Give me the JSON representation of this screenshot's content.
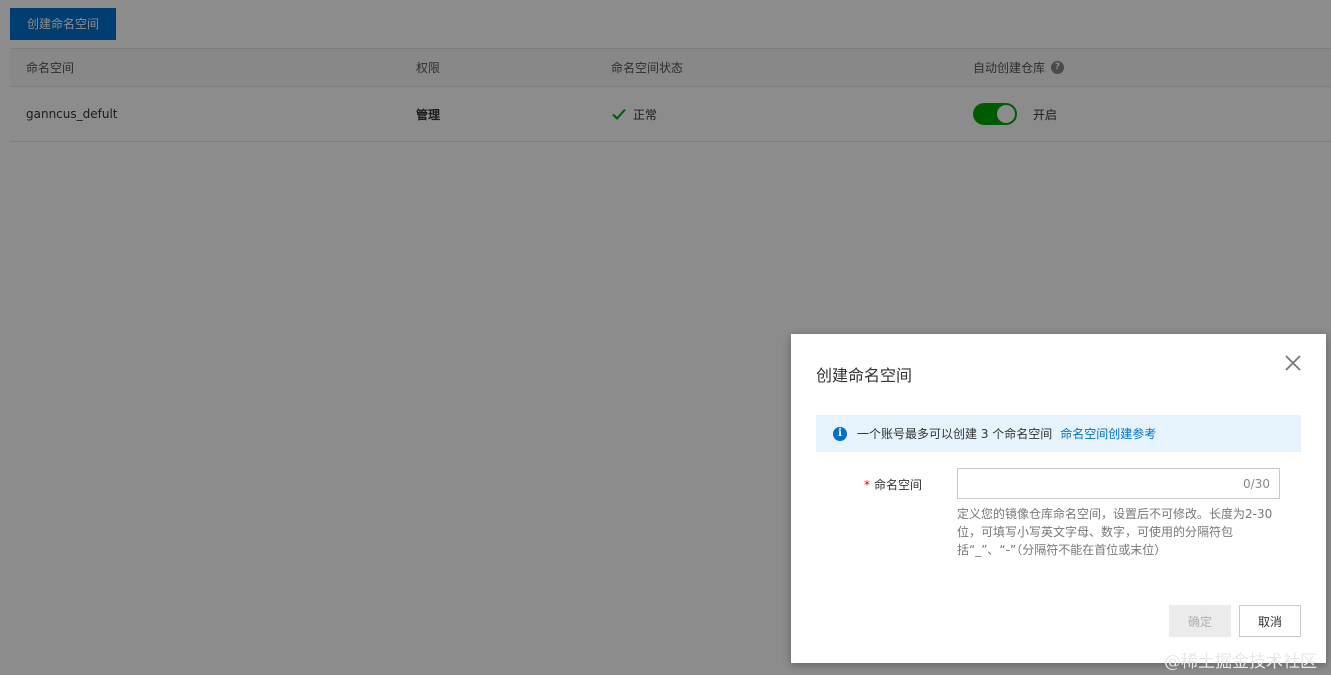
{
  "page": {
    "create_button": "创建命名空间"
  },
  "table": {
    "columns": [
      "命名空间",
      "权限",
      "命名空间状态",
      "自动创建仓库"
    ],
    "help_icon": "?",
    "rows": [
      {
        "namespace": "ganncus_defult",
        "permission": "管理",
        "status": "正常",
        "auto_create": true,
        "auto_create_label": "开启"
      }
    ]
  },
  "dialog": {
    "title": "创建命名空间",
    "info_icon": "i",
    "info_text": "一个账号最多可以创建 3 个命名空间",
    "info_link": "命名空间创建参考",
    "field_required_mark": "*",
    "field_label": "命名空间",
    "field_value": "",
    "counter": "0/30",
    "hint": "定义您的镜像仓库命名空间，设置后不可修改。长度为2-30位，可填写小写英文字母、数字，可使用的分隔符包括“_”、“-”（分隔符不能在首位或末位）",
    "ok_label": "确定",
    "cancel_label": "取消"
  },
  "watermark": "@稀土掘金技术社区",
  "colors": {
    "primary": "#0070cc",
    "success": "#00a700",
    "mask": "rgba(0,0,0,0.45)"
  }
}
